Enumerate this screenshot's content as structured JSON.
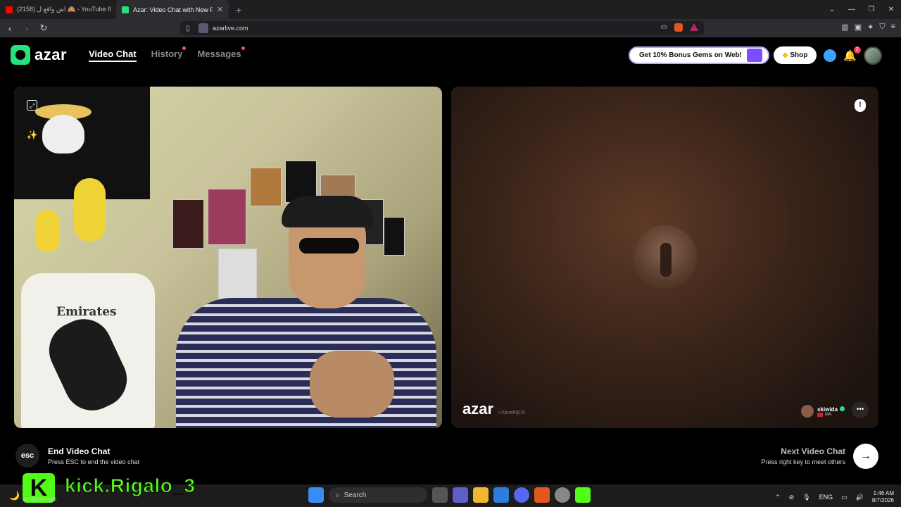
{
  "browser": {
    "tabs": [
      {
        "title": "(2158) اش واقع ل 🙈 - YouTube ‎flow"
      },
      {
        "title": "Azar: Video Chat with New P..."
      }
    ],
    "new_tab": "+",
    "url": "azarlive.com",
    "window_controls": [
      "⌄",
      "—",
      "❐",
      "✕"
    ]
  },
  "app": {
    "logo": "azar",
    "nav": {
      "video_chat": "Video Chat",
      "history": "History",
      "messages": "Messages"
    },
    "promo": "Get 10% Bonus Gems on Web!",
    "shop": "Shop",
    "notification_count": "2"
  },
  "remote": {
    "watermark": "azar",
    "watermark_code": "+70mef0jCR",
    "peer_name": "skiwida",
    "peer_country": "MA"
  },
  "local": {
    "jersey_text": "Emirates"
  },
  "controls": {
    "esc_label": "esc",
    "end_title": "End Video Chat",
    "end_sub": "Press ESC to end the video chat",
    "next_title": "Next Video Chat",
    "next_sub": "Press right key to meet others",
    "next_arrow": "→"
  },
  "overlay": {
    "kick_logo": "K",
    "kick_name": "kick.Rigalo_3",
    "weather_text": "emps de age"
  },
  "taskbar": {
    "search": "Search",
    "lang": "ENG",
    "time": "1:46 AM",
    "date": "8/7/2026"
  },
  "colors": {
    "brand_green": "#29e07e",
    "kick_green": "#53fc18",
    "notification_red": "#ff3b5c"
  }
}
